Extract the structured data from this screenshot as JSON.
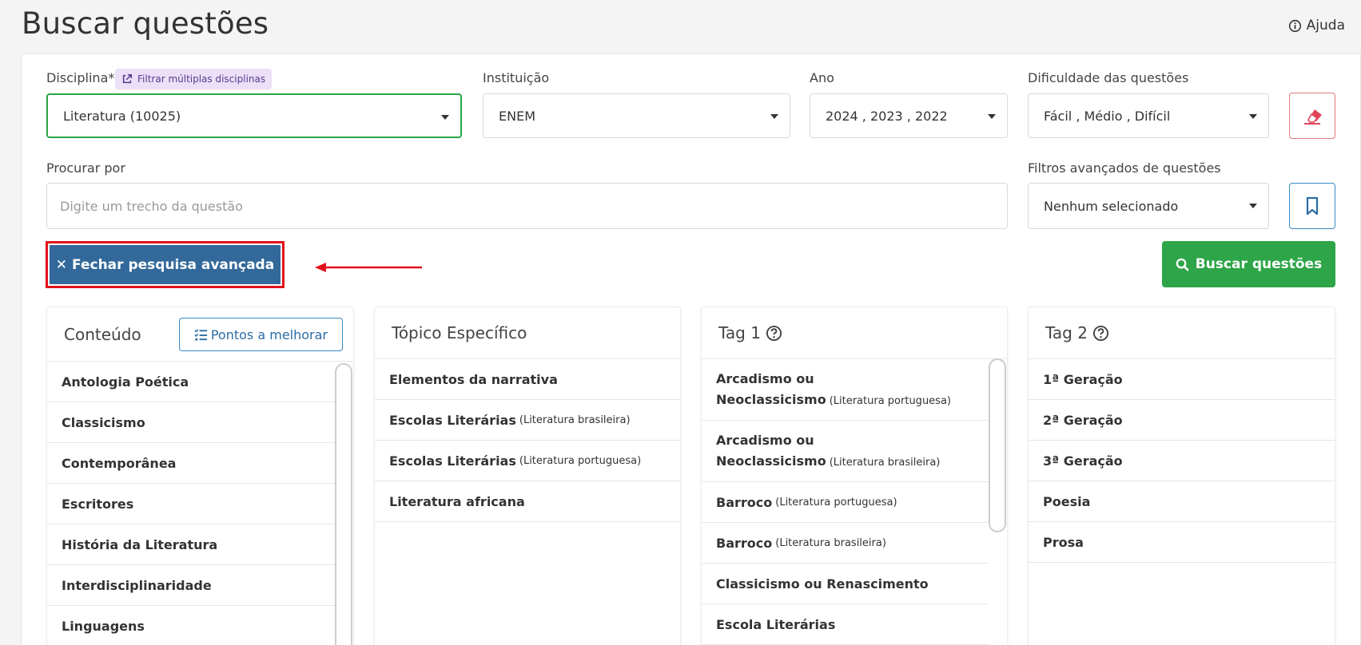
{
  "header": {
    "title": "Buscar questões",
    "help_label": "Ajuda"
  },
  "filters": {
    "disciplina": {
      "label": "Disciplina*",
      "badge": "Filtrar múltiplas disciplinas",
      "value": "Literatura (10025)"
    },
    "instituicao": {
      "label": "Instituição",
      "value": "ENEM"
    },
    "ano": {
      "label": "Ano",
      "value": "2024 , 2023 , 2022"
    },
    "dificuldade": {
      "label": "Dificuldade das questões",
      "value": "Fácil , Médio , Difícil"
    },
    "procurar": {
      "label": "Procurar por",
      "placeholder": "Digite um trecho da questão",
      "value": ""
    },
    "avancados": {
      "label": "Filtros avançados de questões",
      "value": "Nenhum selecionado"
    }
  },
  "actions": {
    "close_advanced": "Fechar pesquisa avançada",
    "search": "Buscar questões"
  },
  "panels": {
    "conteudo": {
      "title": "Conteúdo",
      "button": "Pontos a melhorar",
      "items": [
        "Antologia Poética",
        "Classicismo",
        "Contemporânea",
        "Escritores",
        "História da Literatura",
        "Interdisciplinaridade",
        "Linguagens"
      ]
    },
    "topico": {
      "title": "Tópico Específico",
      "items": [
        {
          "main": "Elementos da narrativa",
          "sub": ""
        },
        {
          "main": "Escolas Literárias",
          "sub": "(Literatura brasileira)"
        },
        {
          "main": "Escolas Literárias",
          "sub": "(Literatura portuguesa)"
        },
        {
          "main": "Literatura africana",
          "sub": ""
        }
      ]
    },
    "tag1": {
      "title": "Tag 1",
      "items": [
        {
          "main": "Arcadismo ou Neoclassicismo",
          "sub": "(Literatura portuguesa)"
        },
        {
          "main": "Arcadismo ou Neoclassicismo",
          "sub": "(Literatura brasileira)"
        },
        {
          "main": "Barroco",
          "sub": "(Literatura portuguesa)"
        },
        {
          "main": "Barroco",
          "sub": "(Literatura brasileira)"
        },
        {
          "main": "Classicismo ou Renascimento",
          "sub": ""
        },
        {
          "main": "Escola Literárias",
          "sub": ""
        }
      ]
    },
    "tag2": {
      "title": "Tag 2",
      "items": [
        "1ª Geração",
        "2ª Geração",
        "3ª Geração",
        "Poesia",
        "Prosa"
      ]
    }
  }
}
